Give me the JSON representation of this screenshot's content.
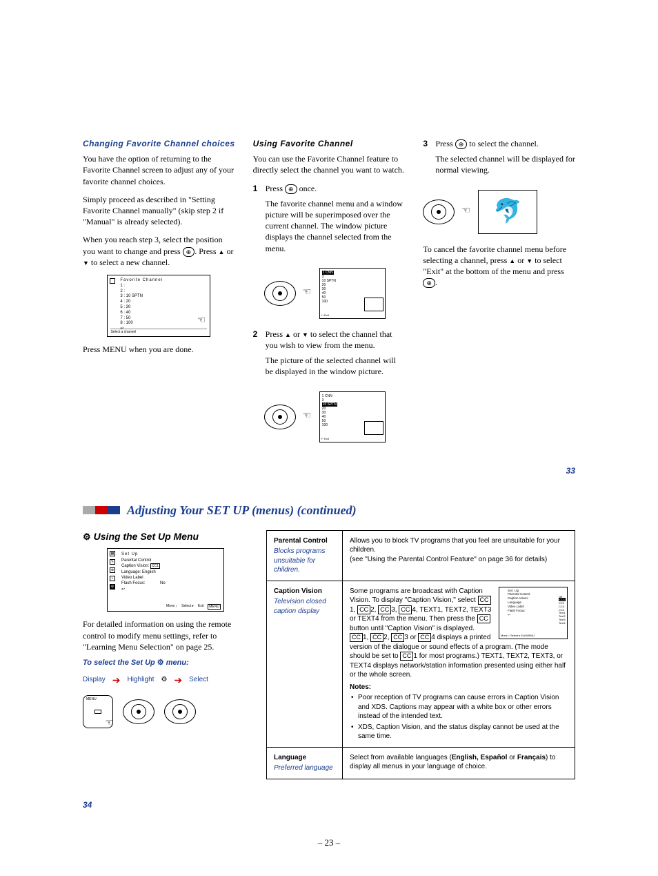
{
  "top": {
    "col1": {
      "heading": "Changing Favorite Channel choices",
      "p1": "You have the option of returning to the Favorite Channel screen to adjust any of your favorite channel choices.",
      "p2": "Simply proceed as described in \"Setting Favorite Channel manually\" (skip step 2 if \"Manual\" is already selected).",
      "p3_a": "When you reach step 3, select the position you want to change and press ",
      "p3_b": ". Press ",
      "p3_c": " or ",
      "p3_d": " to select a new channel.",
      "favbox": {
        "title": "Favorite Channel",
        "rows": [
          "1 :",
          "2 :",
          "3 :   10 SPTN",
          "4 :   20",
          "5 :   30",
          "6 :   40",
          "7 :   50",
          "8 :   100"
        ],
        "return": "↩",
        "footer": "Select a channel"
      },
      "p4": "Press MENU when you are done."
    },
    "col2": {
      "heading": "Using Favorite Channel",
      "p1": "You can use the Favorite Channel feature to directly select the channel you want to watch.",
      "step1_a": "Press ",
      "step1_b": " once.",
      "step1_body": "The favorite channel menu and a window picture will be superimposed over the current channel. The window picture displays the channel selected from the menu.",
      "tv1": {
        "list": [
          "1 CNN",
          "3",
          "10 SPTN",
          "20",
          "30",
          "40",
          "50",
          "100"
        ],
        "exit": "↩ Exit"
      },
      "step2_a": "Press ",
      "step2_b": " or ",
      "step2_c": " to select the channel that you wish to view from the menu.",
      "step2_body": "The picture of the selected channel will be displayed in the window picture.",
      "tv2": {
        "list": [
          "1 CNN",
          "3",
          "10 SPTN",
          "20",
          "30",
          "40",
          "50",
          "100"
        ],
        "exit": "↩ Exit"
      }
    },
    "col3": {
      "step3_a": "Press ",
      "step3_b": " to select the channel.",
      "step3_body": "The selected channel will be displayed for normal viewing.",
      "cancel_a": "To cancel the favorite channel menu before selecting a channel, press ",
      "cancel_b": " or ",
      "cancel_c": " to select \"Exit\" at the bottom of the menu and press ",
      "cancel_d": "."
    },
    "page_num_right": "33"
  },
  "section": {
    "title": "Adjusting Your SET UP (menus) (continued)",
    "left": {
      "heading": "Using the Set Up Menu",
      "setup_box": {
        "title": "Set Up",
        "rows": [
          {
            "l": "Parental Control",
            "r": ""
          },
          {
            "l": "Caption Vision:",
            "r": "CC1"
          },
          {
            "l": "Language:",
            "r": "English"
          },
          {
            "l": "Video Label",
            "r": ""
          },
          {
            "l": "Flash Focus:",
            "r": "No"
          }
        ],
        "return": "↩",
        "footer_move": "Move ↕",
        "footer_select": "Select ▸",
        "footer_exit": "Exit",
        "footer_exit_btn": "MENU"
      },
      "p1": "For detailed information on using the remote control to modify menu settings, refer to \"Learning Menu Selection\" on page 25.",
      "subtitle_a": "To select the Set Up ",
      "subtitle_b": " menu:",
      "flow": {
        "a": "Display",
        "b": "Highlight",
        "c": "Select"
      },
      "remote_label": "MENU"
    },
    "table": {
      "r1": {
        "title": "Parental Control",
        "sub": "Blocks programs unsuitable for children.",
        "body_a": "Allows you to block TV programs that you feel are unsuitable for your children.",
        "body_b": "(see \"Using the Parental Control Feature\" on page 36 for details)"
      },
      "r2": {
        "title": "Caption Vision",
        "sub": "Television closed caption display",
        "line1": "Some programs are broadcast with Caption Vision. To display \"Caption Vision,\" select ",
        "cc1": "CC",
        "n1": "1, ",
        "cc2": "CC",
        "n2": "2, ",
        "cc3": "CC",
        "n3": "3, ",
        "cc4": "CC",
        "n4": "4, TEXT1, TEXT2, TEXT3 or TEXT4 from the menu. Then press the ",
        "ccbtn": "CC",
        "line1b": " button until \"Caption Vision\" is displayed.",
        "line2a": "",
        "cc5": "CC",
        "n5": "1, ",
        "cc6": "CC",
        "n6": "2, ",
        "cc7": "CC",
        "n7": "3 or ",
        "cc8": "CC",
        "n8": "4 displays a printed version of the dialogue or sound effects of a program. (The mode should be set to ",
        "cc9": "CC",
        "n9": "1 for most programs.) TEXT1, TEXT2, TEXT3, or TEXT4 displays network/station information presented using either half or the whole screen.",
        "notes_label": "Notes:",
        "bullet1": "Poor reception of TV programs can cause errors in Caption Vision and XDS. Captions may appear with a white box or other errors instead of the intended text.",
        "bullet2": "XDS, Caption Vision, and the status display cannot be used at the same time.",
        "mini": {
          "title": "Set Up",
          "rows": [
            "Parental Control",
            "Caption Vision:",
            "Language",
            "Video Label",
            "Flash Focus:"
          ],
          "side": [
            "Off",
            "CC1",
            "CC2",
            "CC3",
            "CC4",
            "Text1",
            "Text2",
            "Text3",
            "Text4"
          ],
          "footer": "Move ↕   Select ▸   Exit MENU"
        }
      },
      "r3": {
        "title": "Language",
        "sub": "Preferred language",
        "body_a": "Select from available languages (",
        "body_bold": "English, Español",
        "body_mid": " or ",
        "body_bold2": "Français",
        "body_b": ") to display all menus in your language of choice."
      }
    },
    "page_num_left": "34"
  },
  "footer_page": "– 23 –",
  "glyphs": {
    "plus_btn": "⊕",
    "gear": "⌂"
  }
}
